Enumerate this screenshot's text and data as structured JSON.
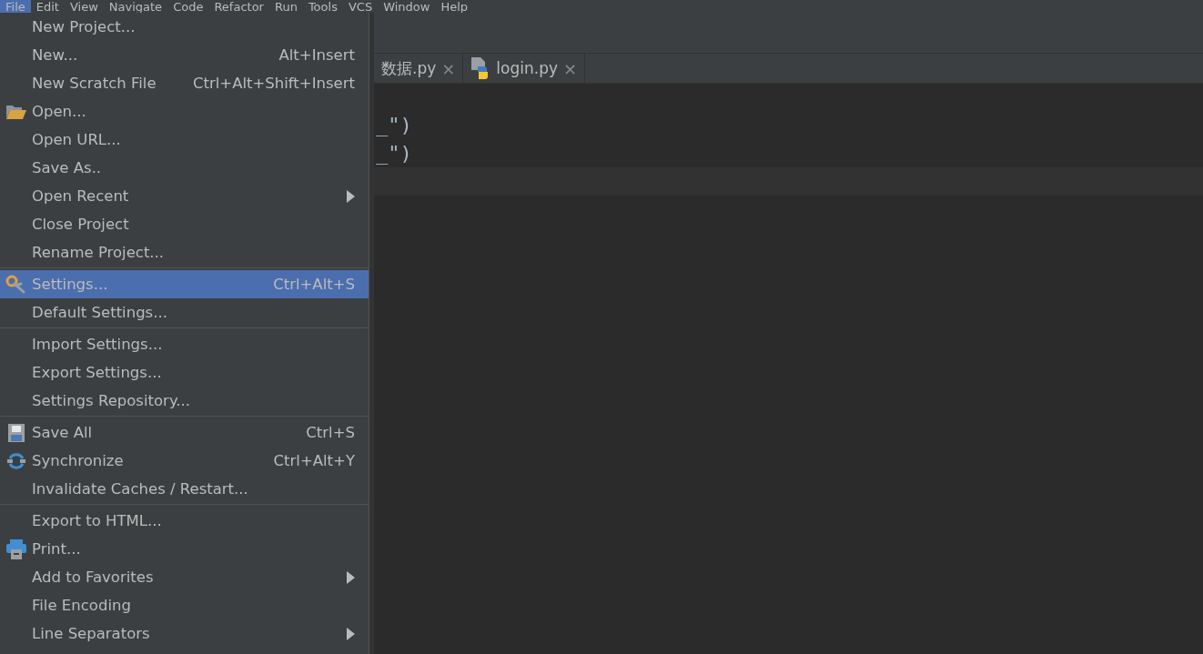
{
  "menu_bar": [
    {
      "label": "File",
      "selected": true
    },
    {
      "label": "Edit",
      "selected": false
    },
    {
      "label": "View",
      "selected": false
    },
    {
      "label": "Navigate",
      "selected": false
    },
    {
      "label": "Code",
      "selected": false
    },
    {
      "label": "Refactor",
      "selected": false
    },
    {
      "label": "Run",
      "selected": false
    },
    {
      "label": "Tools",
      "selected": false
    },
    {
      "label": "VCS",
      "selected": false
    },
    {
      "label": "Window",
      "selected": false
    },
    {
      "label": "Help",
      "selected": false
    }
  ],
  "tabs": [
    {
      "label": "数据.py",
      "kind": "plain",
      "close": "×"
    },
    {
      "label": "login.py",
      "kind": "python",
      "close": "×"
    }
  ],
  "code_lines": [
    "_\")",
    "_\")"
  ],
  "file_menu": [
    [
      {
        "label": "New Project...",
        "selected": false
      },
      {
        "label": "New...",
        "shortcut": "Alt+Insert",
        "selected": false
      },
      {
        "label": "New Scratch File",
        "shortcut": "Ctrl+Alt+Shift+Insert",
        "selected": false
      },
      {
        "label": "Open...",
        "kind": "folder",
        "selected": false
      },
      {
        "label": "Open URL...",
        "selected": false
      },
      {
        "label": "Save As..",
        "selected": false
      },
      {
        "label": "Open Recent",
        "submenu": true,
        "selected": false
      },
      {
        "label": "Close Project",
        "selected": false
      },
      {
        "label": "Rename Project...",
        "selected": false
      }
    ],
    [
      {
        "label": "Settings...",
        "kind": "settings",
        "shortcut": "Ctrl+Alt+S",
        "selected": true
      },
      {
        "label": "Default Settings...",
        "selected": false
      }
    ],
    [
      {
        "label": "Import Settings...",
        "selected": false
      },
      {
        "label": "Export Settings...",
        "selected": false
      },
      {
        "label": "Settings Repository...",
        "selected": false
      }
    ],
    [
      {
        "label": "Save All",
        "kind": "save",
        "shortcut": "Ctrl+S",
        "selected": false
      },
      {
        "label": "Synchronize",
        "kind": "sync",
        "shortcut": "Ctrl+Alt+Y",
        "selected": false
      },
      {
        "label": "Invalidate Caches / Restart...",
        "selected": false
      }
    ],
    [
      {
        "label": "Export to HTML...",
        "selected": false
      },
      {
        "label": "Print...",
        "kind": "print",
        "selected": false
      },
      {
        "label": "Add to Favorites",
        "submenu": true,
        "selected": false
      },
      {
        "label": "File Encoding",
        "selected": false
      },
      {
        "label": "Line Separators",
        "submenu": true,
        "selected": false
      }
    ]
  ]
}
